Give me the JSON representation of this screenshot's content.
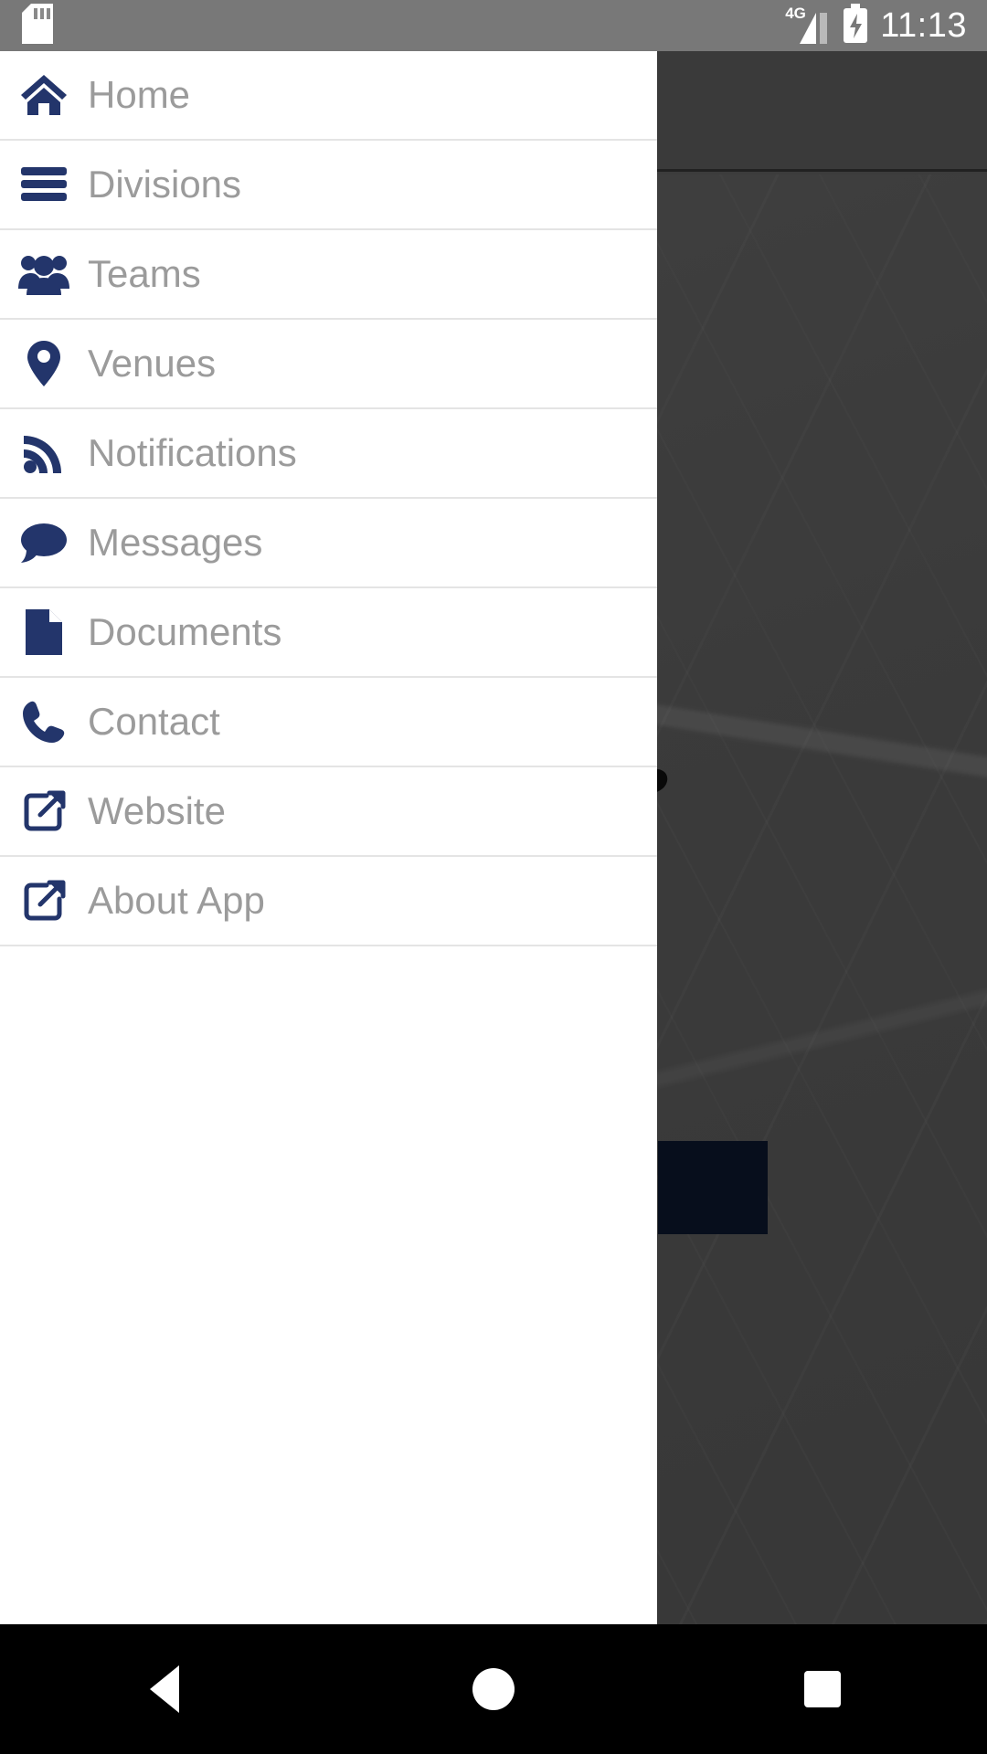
{
  "status_bar": {
    "sd_card_icon": "sd-card-icon",
    "network_label": "4G",
    "signal_icon": "signal-bars-icon",
    "battery_icon": "battery-charging-icon",
    "time": "11:13"
  },
  "drawer": {
    "items": [
      {
        "label": "Home",
        "icon": "home-icon"
      },
      {
        "label": "Divisions",
        "icon": "list-bars-icon"
      },
      {
        "label": "Teams",
        "icon": "users-group-icon"
      },
      {
        "label": "Venues",
        "icon": "map-pin-icon"
      },
      {
        "label": "Notifications",
        "icon": "rss-feed-icon"
      },
      {
        "label": "Messages",
        "icon": "speech-bubble-icon"
      },
      {
        "label": "Documents",
        "icon": "document-page-icon"
      },
      {
        "label": "Contact",
        "icon": "phone-icon"
      },
      {
        "label": "Website",
        "icon": "external-link-icon"
      },
      {
        "label": "About App",
        "icon": "external-link-icon"
      }
    ]
  },
  "nav_bar": {
    "back": "back-button",
    "home": "home-button",
    "recents": "recents-button"
  },
  "colors": {
    "accent_navy": "#23356b",
    "label_gray": "#9b9b9b",
    "divider": "#e4e4e4",
    "status_bar_gray": "#787878",
    "navy_card": "#0d1b33",
    "logo_red": "#a41c1c"
  }
}
